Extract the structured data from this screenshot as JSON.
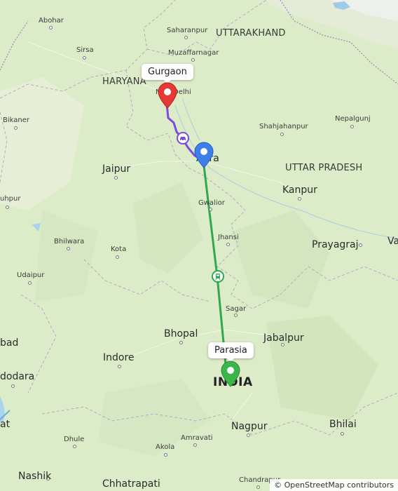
{
  "map": {
    "labels": {
      "abohar": "Abohar",
      "saharanpur": "Saharanpur",
      "uttarakhand": "UTTARAKHAND",
      "sirsa": "Sirsa",
      "muzaffarnagar": "Muzaffarnagar",
      "haryana": "HARYANA",
      "new_delhi": "New Delhi",
      "bikaner": "Bikaner",
      "shahjahanpur": "Shahjahanpur",
      "nepalgunj": "Nepalgunj",
      "agra": "Agra",
      "jaipur": "Jaipur",
      "uttar_pradesh": "UTTAR PRADESH",
      "kanpur": "Kanpur",
      "churu_partial": "uhpur",
      "gwalior": "Gwalior",
      "jhansi": "Jhansi",
      "bhilwara": "Bhilwara",
      "kota": "Kota",
      "prayagraj": "Prayagraj",
      "varanasi_partial": "Va",
      "udaipur": "Udaipur",
      "sagar": "Sagar",
      "ahmedabad_partial": "bad",
      "bhopal": "Bhopal",
      "jabalpur": "Jabalpur",
      "indore": "Indore",
      "vadodara_partial": "dodara",
      "india": "INDIA",
      "surat_partial": "at",
      "nagpur": "Nagpur",
      "bhilai": "Bhilai",
      "dhule": "Dhule",
      "amravati": "Amravati",
      "akola": "Akola",
      "nashik": "Nashik",
      "chhatrapati": "Chhatrapati",
      "chandrapur": "Chandrapur"
    },
    "callouts": {
      "origin": "Gurgaon",
      "destination": "Parasia"
    },
    "route": {
      "segment_road_color": "#7c4ddb",
      "segment_rail_color": "#2fa84f"
    },
    "markers": {
      "origin_color": "#e53935",
      "waypoint_color": "#3d7ee8",
      "destination_color": "#3cb54a"
    },
    "attribution": "© OpenStreetMap contributors"
  }
}
